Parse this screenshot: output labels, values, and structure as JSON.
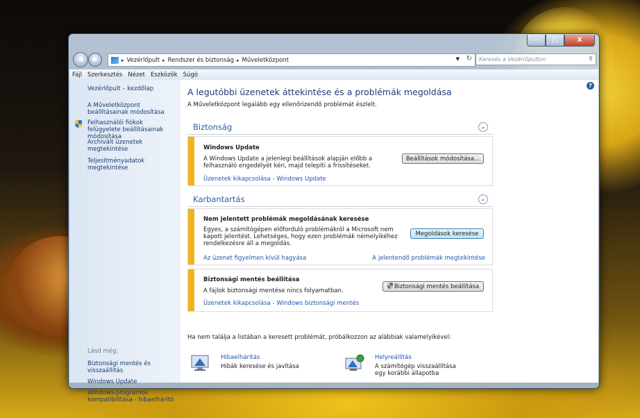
{
  "window": {
    "buttons": {
      "minimize": "—",
      "maximize": "□",
      "close": "X"
    }
  },
  "address": {
    "breadcrumbs": [
      "Vezérlőpult",
      "Rendszer és biztonság",
      "Műveletközpont"
    ],
    "search_placeholder": "Keresés a Vezérlőpulton"
  },
  "menubar": [
    "Fájl",
    "Szerkesztés",
    "Nézet",
    "Eszközök",
    "Súgó"
  ],
  "sidebar": {
    "items": [
      {
        "label": "Vezérlőpult – kezdőlap"
      },
      {
        "label": "A Műveletközpont beállításainak módosítása"
      },
      {
        "label": "Felhasználói fiókok felügyelete beállításainak módosítása",
        "icon": "uac-shield-icon"
      },
      {
        "label": "Archivált üzenetek megtekintése"
      },
      {
        "label": "Teljesítményadatok megtekintése"
      }
    ],
    "see_also_title": "Lásd még:",
    "see_also": [
      {
        "label": "Biztonsági mentés és visszaállítás"
      },
      {
        "label": "Windows Update"
      },
      {
        "label": "Windows-programok kompatibilitása - hibaelhárító"
      }
    ]
  },
  "main": {
    "title": "A legutóbbi üzenetek áttekintése és a problémák megoldása",
    "subtitle": "A Műveletközpont legalább egy ellenőrizendő problémát észlelt.",
    "sections": [
      {
        "title": "Biztonság",
        "alerts": [
          {
            "heading": "Windows Update",
            "description": "A Windows Update a jelenlegi beállítások alapján előbb a felhasználó engedélyét kéri, majd telepíti a frissítéseket.",
            "link_left": "Üzenetek kikapcsolása - Windows Update",
            "button": "Beállítások módosítása..."
          }
        ]
      },
      {
        "title": "Karbantartás",
        "alerts": [
          {
            "heading": "Nem jelentett problémák megoldásának keresése",
            "description": "Egyes, a számítógépen előforduló problémákról a Microsoft nem kapott jelentést. Lehetséges, hogy ezen problémák némelyikéhez rendelkezésre áll a megoldás.",
            "link_left": "Az üzenet figyelmen kívül hagyása",
            "link_right": "A jelentendő problémák megtekintése",
            "button": "Megoldások keresése"
          },
          {
            "heading": "Biztonsági mentés beállítása",
            "description": "A fájlok biztonsági mentése nincs folyamatban.",
            "link_left": "Üzenetek kikapcsolása - Windows biztonsági mentés",
            "button": "Biztonsági mentés beállítása"
          }
        ]
      }
    ],
    "footer_text": "Ha nem találja a listában a keresett problémát, próbálkozzon az alábbiak valamelyikével:",
    "tools": [
      {
        "label": "Hibaelhárítás",
        "desc": "Hibák keresése és javítása",
        "icon": "troubleshoot-icon"
      },
      {
        "label": "Helyreállítás",
        "desc": "A számítógép visszaállítása egy korábbi állapotba",
        "icon": "recovery-icon"
      }
    ]
  },
  "colors": {
    "accent": "#1e3b79",
    "link": "#1e55b3",
    "alert_bar": "#f2b21d"
  }
}
